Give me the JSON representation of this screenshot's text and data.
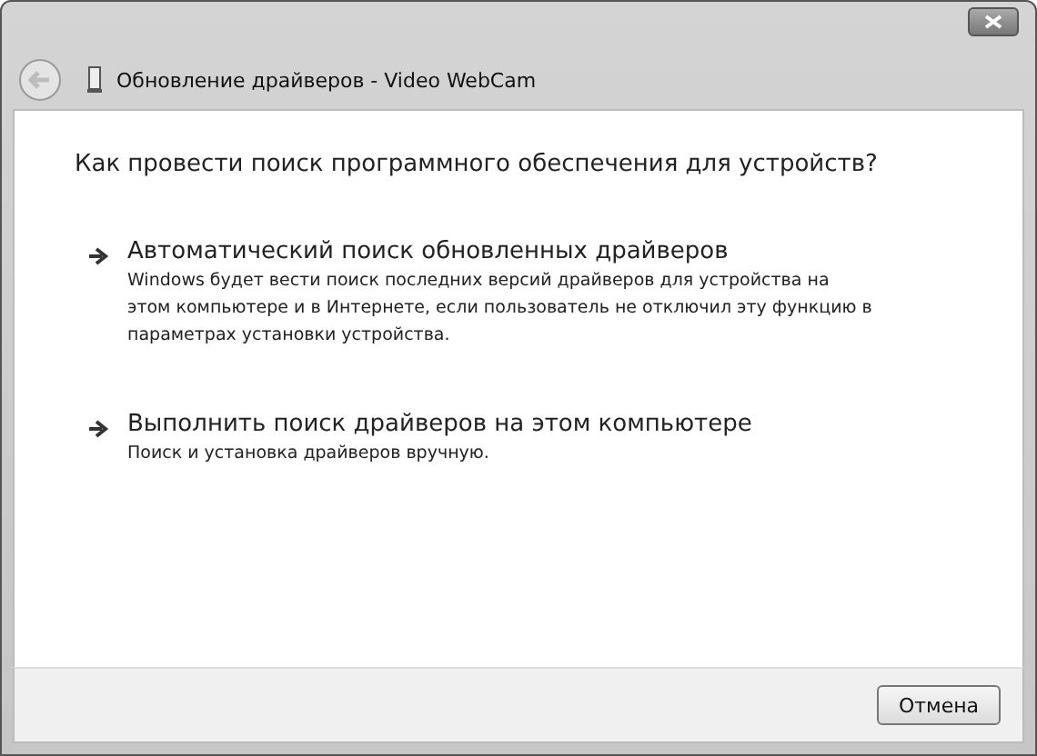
{
  "window": {
    "title": "Обновление драйверов - Video WebCam"
  },
  "heading": "Как провести поиск программного обеспечения для устройств?",
  "options": [
    {
      "title": "Автоматический поиск обновленных драйверов",
      "description": "Windows будет вести поиск последних версий драйверов для устройства на этом компьютере и в Интернете, если пользователь не отключил эту функцию в параметрах установки устройства."
    },
    {
      "title": "Выполнить поиск драйверов на этом компьютере",
      "description": "Поиск и установка драйверов вручную."
    }
  ],
  "buttons": [
    "Отмена"
  ]
}
